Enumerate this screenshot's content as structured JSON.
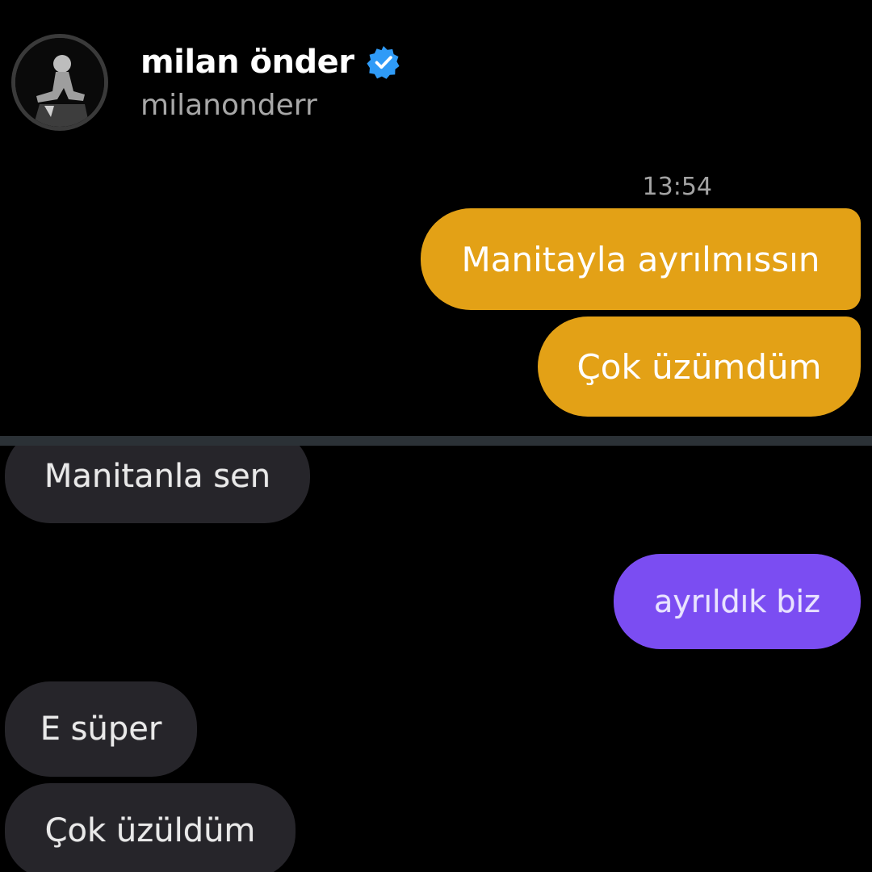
{
  "header": {
    "name": "milan önder",
    "handle": "milanonderr",
    "verified": true,
    "verified_color": "#2f9bf7"
  },
  "thread_top": {
    "timestamp": "13:54",
    "messages": [
      {
        "text": "Manitayla ayrılmıssın",
        "direction": "outgoing",
        "color": "#e3a116"
      },
      {
        "text": "Çok üzümdüm",
        "direction": "outgoing",
        "color": "#e3a116"
      }
    ]
  },
  "thread_bottom": {
    "messages": [
      {
        "text": "Manitanla sen",
        "direction": "incoming",
        "color": "#26252a"
      },
      {
        "text": "ayrıldık biz",
        "direction": "outgoing",
        "color": "#7b4df2"
      },
      {
        "text": "E süper",
        "direction": "incoming",
        "color": "#26252a"
      },
      {
        "text": "Çok üzüldüm",
        "direction": "incoming",
        "color": "#26252a"
      }
    ]
  },
  "icons": {
    "avatar": "profile-photo",
    "verified": "verified-badge-icon"
  }
}
